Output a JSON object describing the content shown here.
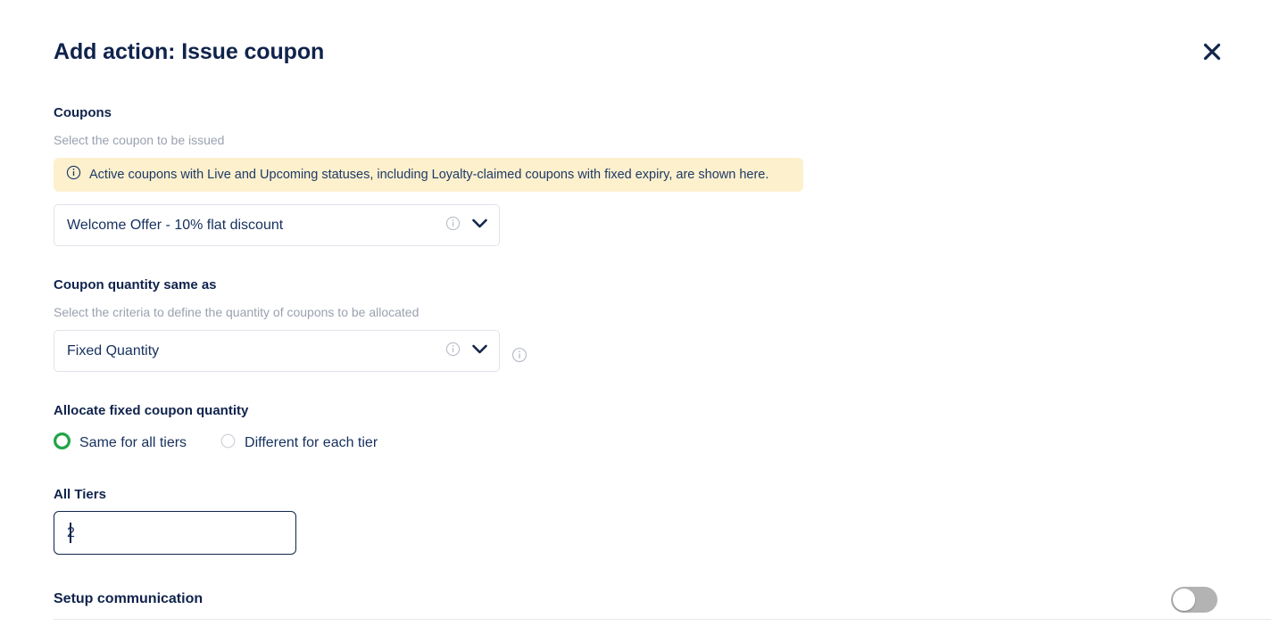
{
  "header": {
    "title": "Add action: Issue coupon",
    "close_icon": "close-icon"
  },
  "coupons_section": {
    "label": "Coupons",
    "help": "Select the coupon to be issued",
    "banner": {
      "icon": "info-circle-icon",
      "text": "Active coupons with Live and Upcoming statuses, including Loyalty-claimed coupons with fixed expiry, are shown here."
    },
    "select": {
      "value": "Welcome Offer - 10% flat discount",
      "info_icon": "info-circle-icon",
      "chevron_icon": "chevron-down-icon"
    }
  },
  "quantity_section": {
    "label": "Coupon quantity same as",
    "help": "Select the criteria to define the quantity of coupons to be allocated",
    "select": {
      "value": "Fixed Quantity",
      "info_icon": "info-circle-icon",
      "chevron_icon": "chevron-down-icon"
    },
    "side_info_icon": "info-circle-icon"
  },
  "allocate_section": {
    "label": "Allocate fixed coupon quantity",
    "options": [
      {
        "label": "Same for all tiers",
        "selected": true
      },
      {
        "label": "Different for each tier",
        "selected": false
      }
    ]
  },
  "tiers_section": {
    "label": "All Tiers",
    "input_value": "2",
    "input_placeholder": "Enter quantity"
  },
  "setup_section": {
    "title": "Setup communication",
    "toggle_state": "off"
  },
  "colors": {
    "navy": "#10234c",
    "banner_bg": "#fdf0cd",
    "radio_green": "#22a447",
    "muted": "#9aa1b0",
    "border": "#dfe3ea"
  }
}
